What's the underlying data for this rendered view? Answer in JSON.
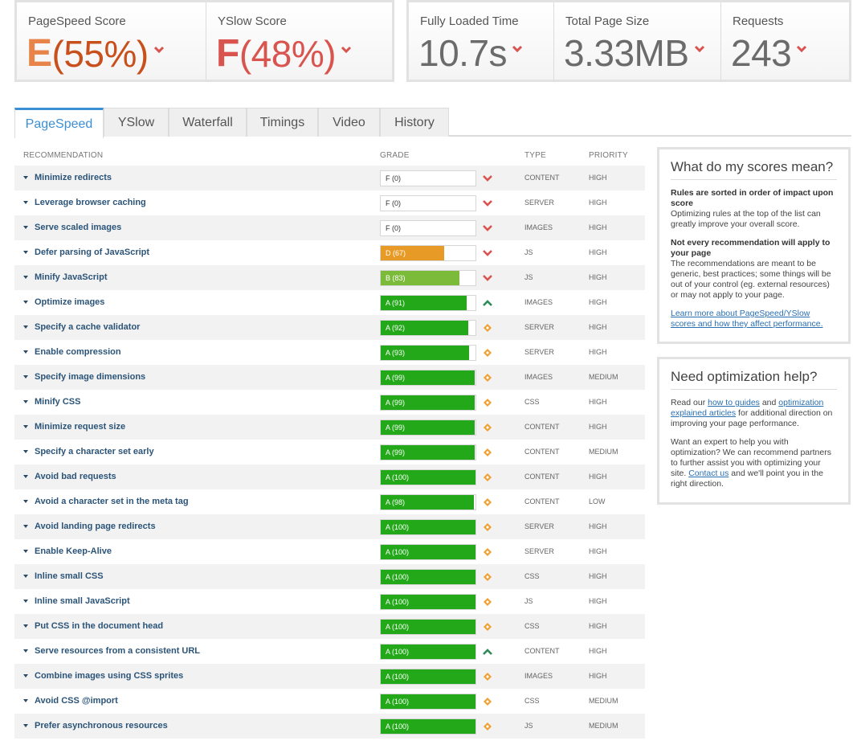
{
  "scores": {
    "pagespeed": {
      "label": "PageSpeed Score",
      "grade": "E",
      "percent": "(55%)"
    },
    "yslow": {
      "label": "YSlow Score",
      "grade": "F",
      "percent": "(48%)"
    },
    "loaded": {
      "label": "Fully Loaded Time",
      "value": "10.7s"
    },
    "size": {
      "label": "Total Page Size",
      "value": "3.33MB"
    },
    "requests": {
      "label": "Requests",
      "value": "243"
    }
  },
  "tabs": [
    {
      "label": "PageSpeed",
      "active": true
    },
    {
      "label": "YSlow"
    },
    {
      "label": "Waterfall"
    },
    {
      "label": "Timings"
    },
    {
      "label": "Video"
    },
    {
      "label": "History"
    }
  ],
  "table": {
    "headers": {
      "recommendation": "RECOMMENDATION",
      "grade": "GRADE",
      "type": "TYPE",
      "priority": "PRIORITY"
    },
    "rows": [
      {
        "name": "Minimize redirects",
        "grade": "F (0)",
        "score": 0,
        "trend": "down",
        "type": "CONTENT",
        "priority": "HIGH"
      },
      {
        "name": "Leverage browser caching",
        "grade": "F (0)",
        "score": 0,
        "trend": "down",
        "type": "SERVER",
        "priority": "HIGH"
      },
      {
        "name": "Serve scaled images",
        "grade": "F (0)",
        "score": 0,
        "trend": "down",
        "type": "IMAGES",
        "priority": "HIGH"
      },
      {
        "name": "Defer parsing of JavaScript",
        "grade": "D (67)",
        "score": 67,
        "trend": "down",
        "type": "JS",
        "priority": "HIGH"
      },
      {
        "name": "Minify JavaScript",
        "grade": "B (83)",
        "score": 83,
        "trend": "down",
        "type": "JS",
        "priority": "HIGH"
      },
      {
        "name": "Optimize images",
        "grade": "A (91)",
        "score": 91,
        "trend": "up",
        "type": "IMAGES",
        "priority": "HIGH"
      },
      {
        "name": "Specify a cache validator",
        "grade": "A (92)",
        "score": 92,
        "trend": "same",
        "type": "SERVER",
        "priority": "HIGH"
      },
      {
        "name": "Enable compression",
        "grade": "A (93)",
        "score": 93,
        "trend": "same",
        "type": "SERVER",
        "priority": "HIGH"
      },
      {
        "name": "Specify image dimensions",
        "grade": "A (99)",
        "score": 99,
        "trend": "same",
        "type": "IMAGES",
        "priority": "MEDIUM"
      },
      {
        "name": "Minify CSS",
        "grade": "A (99)",
        "score": 99,
        "trend": "same",
        "type": "CSS",
        "priority": "HIGH"
      },
      {
        "name": "Minimize request size",
        "grade": "A (99)",
        "score": 99,
        "trend": "same",
        "type": "CONTENT",
        "priority": "HIGH"
      },
      {
        "name": "Specify a character set early",
        "grade": "A (99)",
        "score": 99,
        "trend": "same",
        "type": "CONTENT",
        "priority": "MEDIUM"
      },
      {
        "name": "Avoid bad requests",
        "grade": "A (100)",
        "score": 100,
        "trend": "same",
        "type": "CONTENT",
        "priority": "HIGH"
      },
      {
        "name": "Avoid a character set in the meta tag",
        "grade": "A (98)",
        "score": 98,
        "trend": "same",
        "type": "CONTENT",
        "priority": "LOW"
      },
      {
        "name": "Avoid landing page redirects",
        "grade": "A (100)",
        "score": 100,
        "trend": "same",
        "type": "SERVER",
        "priority": "HIGH"
      },
      {
        "name": "Enable Keep-Alive",
        "grade": "A (100)",
        "score": 100,
        "trend": "same",
        "type": "SERVER",
        "priority": "HIGH"
      },
      {
        "name": "Inline small CSS",
        "grade": "A (100)",
        "score": 100,
        "trend": "same",
        "type": "CSS",
        "priority": "HIGH"
      },
      {
        "name": "Inline small JavaScript",
        "grade": "A (100)",
        "score": 100,
        "trend": "same",
        "type": "JS",
        "priority": "HIGH"
      },
      {
        "name": "Put CSS in the document head",
        "grade": "A (100)",
        "score": 100,
        "trend": "same",
        "type": "CSS",
        "priority": "HIGH"
      },
      {
        "name": "Serve resources from a consistent URL",
        "grade": "A (100)",
        "score": 100,
        "trend": "up",
        "type": "CONTENT",
        "priority": "HIGH"
      },
      {
        "name": "Combine images using CSS sprites",
        "grade": "A (100)",
        "score": 100,
        "trend": "same",
        "type": "IMAGES",
        "priority": "HIGH"
      },
      {
        "name": "Avoid CSS @import",
        "grade": "A (100)",
        "score": 100,
        "trend": "same",
        "type": "CSS",
        "priority": "MEDIUM"
      },
      {
        "name": "Prefer asynchronous resources",
        "grade": "A (100)",
        "score": 100,
        "trend": "same",
        "type": "JS",
        "priority": "MEDIUM"
      }
    ]
  },
  "colors": {
    "grade_a": "#22a819",
    "grade_b": "#7cbb3a",
    "grade_d": "#e79a25",
    "trend_down": "#d9534f",
    "trend_up": "#2e8b57",
    "trend_same": "#f0a030",
    "accent": "#3b8fd4"
  },
  "scores_help": {
    "title": "What do my scores mean?",
    "p1_bold": "Rules are sorted in order of impact upon score",
    "p1_text": "Optimizing rules at the top of the list can greatly improve your overall score.",
    "p2_bold": "Not every recommendation will apply to your page",
    "p2_text": "The recommendations are meant to be generic, best practices; some things will be out of your control (eg. external resources) or may not apply to your page.",
    "link": "Learn more about PageSpeed/YSlow scores and how they affect performance."
  },
  "optimization_help": {
    "title": "Need optimization help?",
    "p1_a": "Read our ",
    "link1": "how to guides",
    "p1_b": " and ",
    "link2": "optimization explained articles",
    "p1_c": " for additional direction on improving your page performance.",
    "p2_a": "Want an expert to help you with optimization? We can recommend partners to further assist you with optimizing your site. ",
    "link3": "Contact us",
    "p2_b": " and we'll point you in the right direction."
  }
}
